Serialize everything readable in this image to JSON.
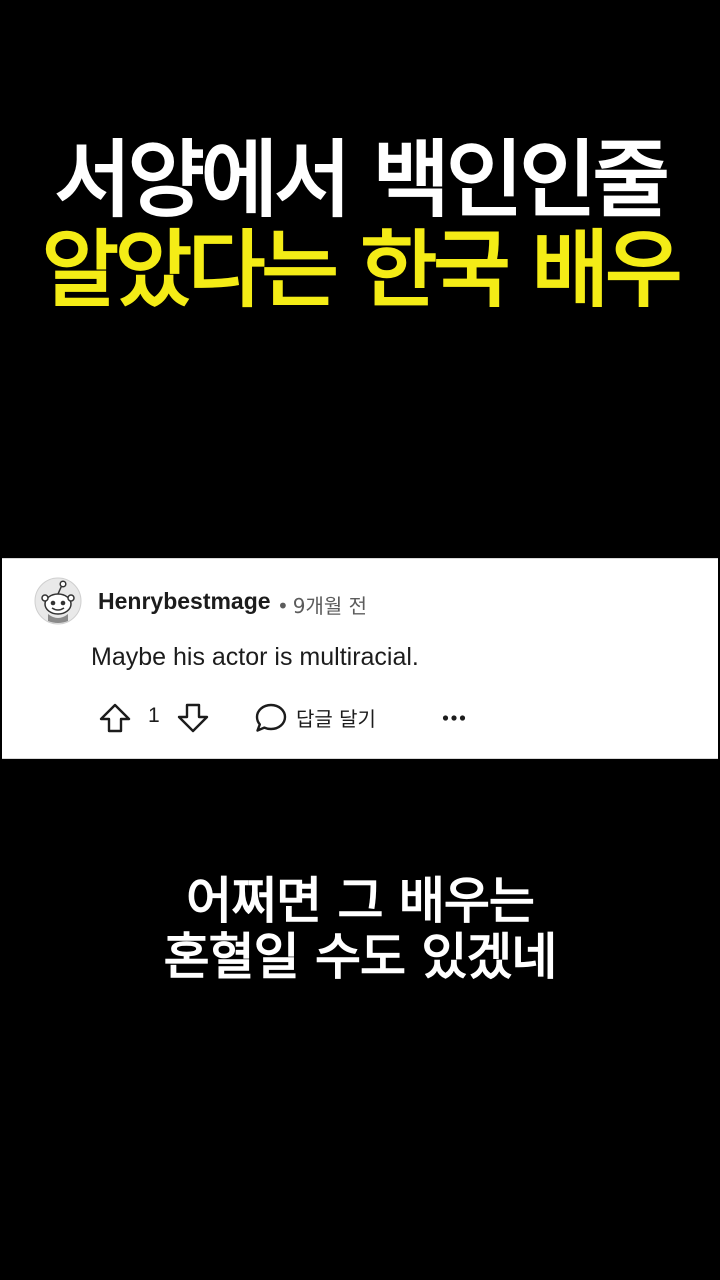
{
  "headline": {
    "line1": "서양에서 백인인줄",
    "line2": "알았다는 한국 배우"
  },
  "comment": {
    "username": "Henrybestmage",
    "separator": "•",
    "time": "9개월 전",
    "body": "Maybe his actor is multiracial.",
    "vote_count": "1",
    "reply_label": "답글 달기",
    "icons": {
      "avatar": "reddit-snoo-avatar",
      "upvote": "arrow-up-icon",
      "downvote": "arrow-down-icon",
      "reply": "speech-bubble-icon",
      "more": "ellipsis-icon"
    }
  },
  "subtitle": {
    "line1": "어쩌면 그 배우는",
    "line2": "혼혈일 수도 있겠네"
  },
  "colors": {
    "background": "#000000",
    "headline_white": "#ffffff",
    "headline_yellow": "#f4ec16",
    "card_background": "#ffffff",
    "meta_gray": "#5c5c5c"
  }
}
